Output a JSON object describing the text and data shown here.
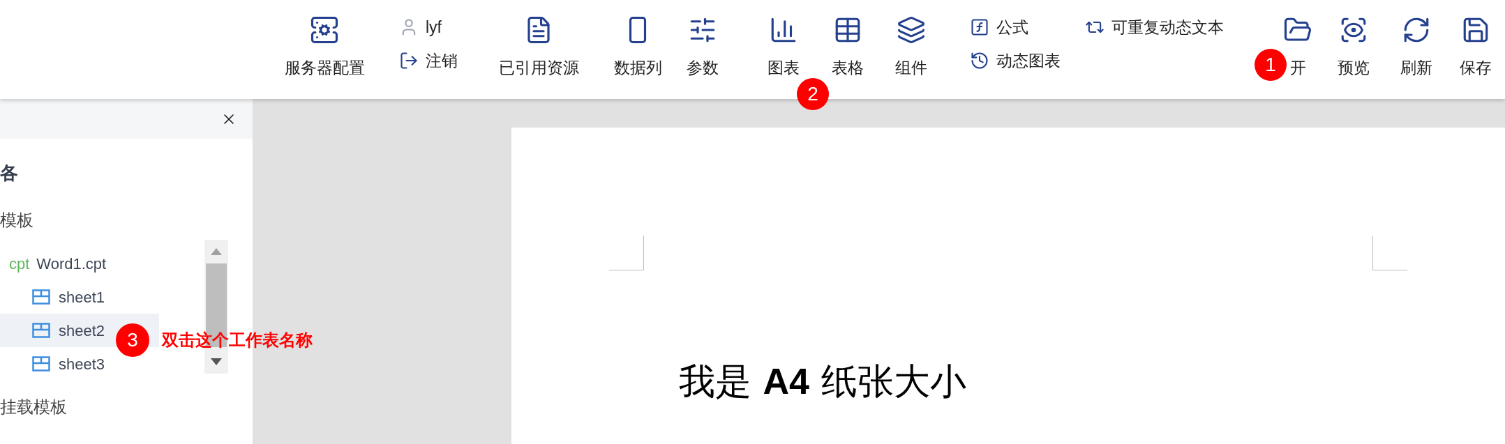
{
  "toolbar": {
    "items": [
      {
        "kind": "button",
        "label": "服务器配置"
      },
      {
        "kind": "stack",
        "rows": [
          {
            "label": "lyf"
          },
          {
            "label": "注销"
          }
        ]
      },
      {
        "kind": "button",
        "label": "已引用资源"
      },
      {
        "kind": "button",
        "label": "数据列"
      },
      {
        "kind": "button",
        "label": "参数"
      },
      {
        "kind": "button",
        "label": "图表"
      },
      {
        "kind": "button",
        "label": "表格"
      },
      {
        "kind": "button",
        "label": "组件"
      },
      {
        "kind": "stack",
        "rows": [
          {
            "label": "公式"
          },
          {
            "label": "动态图表"
          }
        ]
      },
      {
        "kind": "stack",
        "rows": [
          {
            "label": "可重复动态文本"
          }
        ]
      },
      {
        "kind": "button",
        "label": "开"
      },
      {
        "kind": "button",
        "label": "预览"
      },
      {
        "kind": "button",
        "label": "刷新"
      },
      {
        "kind": "button",
        "label": "保存"
      }
    ]
  },
  "panel": {
    "heading": "各",
    "sections": [
      {
        "title": "模板",
        "tree": [
          {
            "tag": "cpt",
            "label": "Word1.cpt",
            "selected": false,
            "children": [
              {
                "label": "sheet1",
                "selected": false
              },
              {
                "label": "sheet2",
                "selected": true
              },
              {
                "label": "sheet3",
                "selected": false
              }
            ]
          }
        ]
      },
      {
        "title": "挂载模板"
      }
    ]
  },
  "document": {
    "text": "我是 **A4** 纸张大小"
  },
  "annotations": [
    {
      "label": "1"
    },
    {
      "label": "2"
    },
    {
      "label": "3",
      "note": "双击这个工作表名称"
    }
  ]
}
